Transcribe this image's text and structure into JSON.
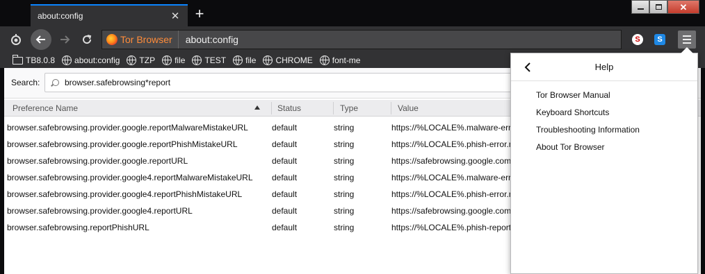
{
  "tab": {
    "title": "about:config",
    "close_icon": "close-icon",
    "new_tab_icon": "plus-icon"
  },
  "nav": {
    "identity_label": "Tor Browser",
    "url": "about:config",
    "back_icon": "arrow-left-icon",
    "forward_icon": "arrow-right-icon",
    "reload_icon": "reload-icon",
    "onion_icon": "onion-icon",
    "ext1": "S",
    "ext2": "S"
  },
  "bookmarks": [
    {
      "label": "TB8.0.8",
      "icon": "folder-icon"
    },
    {
      "label": "about:config",
      "icon": "globe-icon"
    },
    {
      "label": "TZP",
      "icon": "globe-icon"
    },
    {
      "label": "file",
      "icon": "globe-icon"
    },
    {
      "label": "TEST",
      "icon": "globe-icon"
    },
    {
      "label": "file",
      "icon": "globe-icon"
    },
    {
      "label": "CHROME",
      "icon": "globe-icon"
    },
    {
      "label": "font-me",
      "icon": "globe-icon"
    }
  ],
  "search": {
    "label": "Search:",
    "value": "browser.safebrowsing*report"
  },
  "table": {
    "headers": {
      "name": "Preference Name",
      "status": "Status",
      "type": "Type",
      "value": "Value"
    },
    "rows": [
      {
        "name": "browser.safebrowsing.provider.google.reportMalwareMistakeURL",
        "status": "default",
        "type": "string",
        "value": "https://%LOCALE%.malware-error.m"
      },
      {
        "name": "browser.safebrowsing.provider.google.reportPhishMistakeURL",
        "status": "default",
        "type": "string",
        "value": "https://%LOCALE%.phish-error.m"
      },
      {
        "name": "browser.safebrowsing.provider.google.reportURL",
        "status": "default",
        "type": "string",
        "value": "https://safebrowsing.google.com"
      },
      {
        "name": "browser.safebrowsing.provider.google4.reportMalwareMistakeURL",
        "status": "default",
        "type": "string",
        "value": "https://%LOCALE%.malware-error.m"
      },
      {
        "name": "browser.safebrowsing.provider.google4.reportPhishMistakeURL",
        "status": "default",
        "type": "string",
        "value": "https://%LOCALE%.phish-error.m"
      },
      {
        "name": "browser.safebrowsing.provider.google4.reportURL",
        "status": "default",
        "type": "string",
        "value": "https://safebrowsing.google.com"
      },
      {
        "name": "browser.safebrowsing.reportPhishURL",
        "status": "default",
        "type": "string",
        "value": "https://%LOCALE%.phish-report"
      }
    ]
  },
  "help": {
    "title": "Help",
    "items": [
      "Tor Browser Manual",
      "Keyboard Shortcuts",
      "Troubleshooting Information",
      "About Tor Browser"
    ]
  },
  "colors": {
    "accent": "#0a84ff",
    "toolbar": "#323234",
    "tabstrip": "#0b0b0d",
    "close": "#c43c2c"
  }
}
